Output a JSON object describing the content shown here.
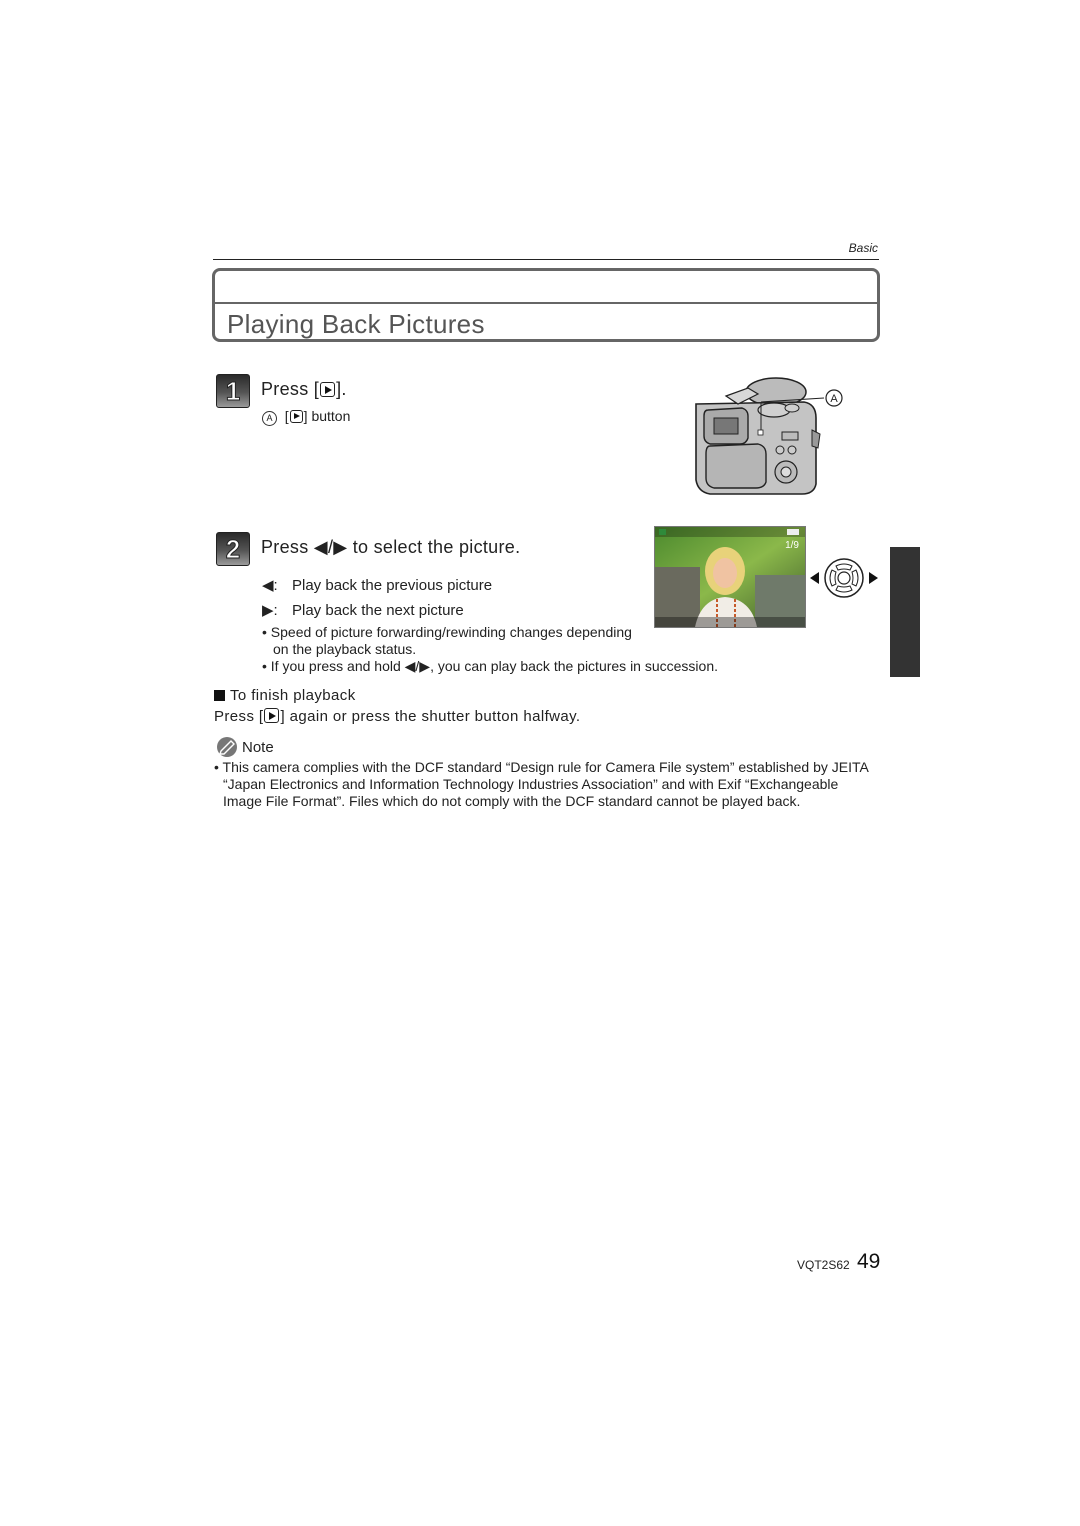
{
  "header": {
    "section_label": "Basic"
  },
  "title": "Playing Back Pictures",
  "step1": {
    "number": "1",
    "heading_prefix": "Press [",
    "heading_suffix": "].",
    "callout_letter": "A",
    "callout_prefix": "[",
    "callout_suffix": "] button",
    "figure_label": "A"
  },
  "step2": {
    "number": "2",
    "heading": "Press ◀/▶ to select the picture.",
    "items": [
      {
        "key": "◀:",
        "text": "Play back the previous picture"
      },
      {
        "key": "▶:",
        "text": "Play back the next picture"
      }
    ],
    "bullets": [
      "• Speed of picture forwarding/rewinding changes depending on the playback status.",
      "• If you press and hold ◀/▶, you can play back the pictures in succession."
    ],
    "screen": {
      "counter": "1/9"
    }
  },
  "finish": {
    "heading": "To finish playback",
    "body_prefix": "Press [",
    "body_suffix": "] again or press the shutter button halfway."
  },
  "note": {
    "label": "Note",
    "text": "• This camera complies with the DCF standard “Design rule for Camera File system” established by JEITA “Japan Electronics and Information Technology Industries Association” and with Exif “Exchangeable Image File Format”. Files which do not comply with the DCF standard cannot be played back."
  },
  "footer": {
    "code": "VQT2S62",
    "page": "49"
  }
}
